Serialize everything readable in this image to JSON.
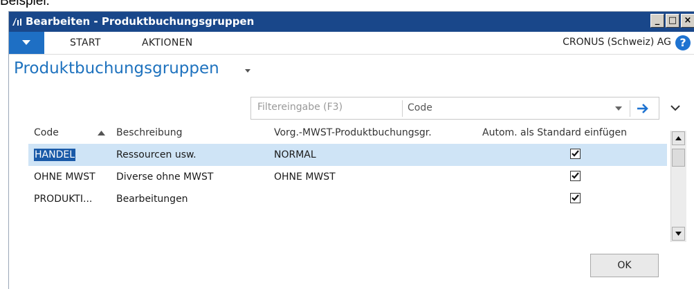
{
  "caption": "Beispiel:",
  "window": {
    "title": "Bearbeiten - Produktbuchungsgruppen",
    "minimize_glyph": "_",
    "maximize_glyph": "□",
    "close_glyph": "×"
  },
  "ribbon": {
    "tabs": [
      "START",
      "AKTIONEN"
    ],
    "company": "CRONUS (Schweiz) AG",
    "help_glyph": "?"
  },
  "page": {
    "title": "Produktbuchungsgruppen"
  },
  "filter": {
    "placeholder": "Filtereingabe (F3)",
    "field": "Code"
  },
  "table": {
    "columns": [
      "Code",
      "Beschreibung",
      "Vorg.-MWST-Produktbuchungsgr.",
      "Autom. als Standard einfügen"
    ],
    "sort_column": "Code",
    "sort_direction": "ascending",
    "rows": [
      {
        "code": "HANDEL",
        "beschreibung": "Ressourcen usw.",
        "vorg_mwst": "NORMAL",
        "autom_standard": true,
        "selected": true
      },
      {
        "code": "OHNE MWST",
        "beschreibung": "Diverse ohne MWST",
        "vorg_mwst": "OHNE MWST",
        "autom_standard": true,
        "selected": false
      },
      {
        "code": "PRODUKTI...",
        "beschreibung": "Bearbeitungen",
        "vorg_mwst": "",
        "autom_standard": true,
        "selected": false
      }
    ]
  },
  "buttons": {
    "ok": "OK"
  },
  "colors": {
    "titlebar": "#19478a",
    "accent": "#1e72be",
    "selected_row": "#cfe4f6"
  }
}
